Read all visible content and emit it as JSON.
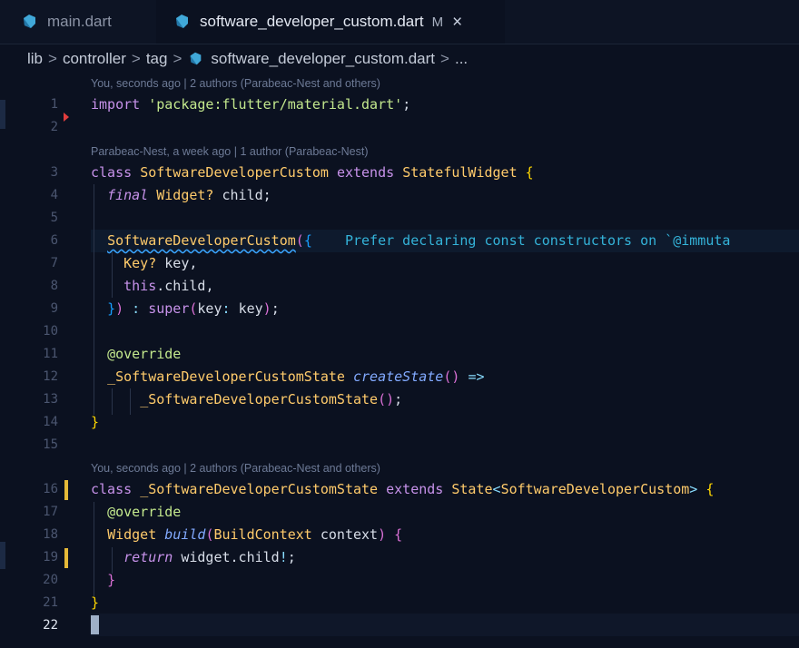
{
  "tabs": [
    {
      "label": "main.dart",
      "icon": "dart-icon"
    },
    {
      "label": "software_developer_custom.dart",
      "modified": "M",
      "close": "×",
      "icon": "dart-icon"
    }
  ],
  "breadcrumb": {
    "parts": [
      "lib",
      "controller",
      "tag",
      "software_developer_custom.dart",
      "..."
    ],
    "separator": ">"
  },
  "codelens": {
    "l1": "You, seconds ago | 2 authors (Parabeac-Nest and others)",
    "l3": "Parabeac-Nest, a week ago | 1 author (Parabeac-Nest)",
    "l16": "You, seconds ago | 2 authors (Parabeac-Nest and others)"
  },
  "line_numbers": [
    "1",
    "2",
    "3",
    "4",
    "5",
    "6",
    "7",
    "8",
    "9",
    "10",
    "11",
    "12",
    "13",
    "14",
    "15",
    "16",
    "17",
    "18",
    "19",
    "20",
    "21",
    "22"
  ],
  "code": {
    "import_kw": "import",
    "import_str": "'package:flutter/material.dart'",
    "class_kw": "class",
    "class_name": "SoftwareDeveloperCustom",
    "extends_kw": "extends",
    "stateful": "StatefulWidget",
    "final_kw": "final",
    "widget_type": "Widget?",
    "child": "child",
    "ctor": "SoftwareDeveloperCustom",
    "hint": "Prefer declaring const constructors on `@immuta",
    "key_type": "Key?",
    "key": "key",
    "this_kw": "this",
    "super_kw": "super",
    "override": "@override",
    "state_type": "_SoftwareDeveloperCustomState",
    "create_state": "createState",
    "arrow": "=>",
    "state_class": "_SoftwareDeveloperCustomState",
    "state_kw": "State",
    "widget": "Widget",
    "build": "build",
    "build_ctx": "BuildContext",
    "context": "context",
    "return_kw": "return",
    "widget_child": "widget.child"
  },
  "colors": {
    "background": "#0b1120",
    "keyword": "#c792ea",
    "string": "#c3e88d",
    "type": "#ffcb6b",
    "function": "#82aaff",
    "hint": "#34b3d9",
    "git_modified": "#e5b938"
  }
}
